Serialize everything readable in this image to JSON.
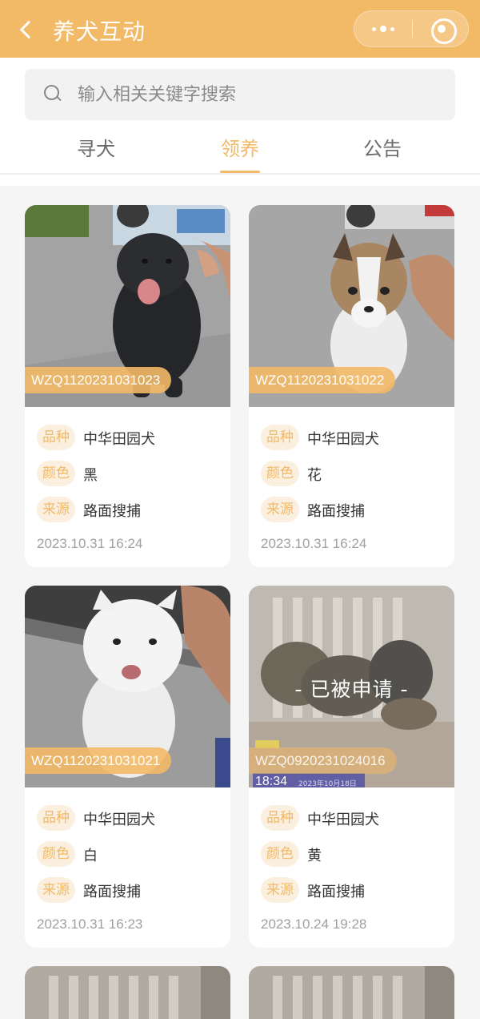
{
  "header": {
    "title": "养犬互动"
  },
  "search": {
    "placeholder": "输入相关关键字搜索"
  },
  "tabs": [
    {
      "label": "寻犬",
      "active": false
    },
    {
      "label": "领养",
      "active": true
    },
    {
      "label": "公告",
      "active": false
    }
  ],
  "field_labels": {
    "breed": "品种",
    "color": "颜色",
    "source": "来源"
  },
  "status_text": "- 已被申请 -",
  "cards": [
    {
      "id": "WZQ1120231031023",
      "breed": "中华田园犬",
      "color": "黑",
      "source": "路面搜捕",
      "time": "2023.10.31 16:24",
      "applied": false
    },
    {
      "id": "WZQ1120231031022",
      "breed": "中华田园犬",
      "color": "花",
      "source": "路面搜捕",
      "time": "2023.10.31 16:24",
      "applied": false
    },
    {
      "id": "WZQ1120231031021",
      "breed": "中华田园犬",
      "color": "白",
      "source": "路面搜捕",
      "time": "2023.10.31 16:23",
      "applied": false
    },
    {
      "id": "WZQ0920231024016",
      "breed": "中华田园犬",
      "color": "黄",
      "source": "路面搜捕",
      "time": "2023.10.24 19:28",
      "applied": true
    }
  ],
  "theme": {
    "accent": "#f2b966",
    "label_bg": "#fbf0df"
  },
  "photo_overlay": {
    "clock": "18:34",
    "date": "2023年10月18日"
  }
}
